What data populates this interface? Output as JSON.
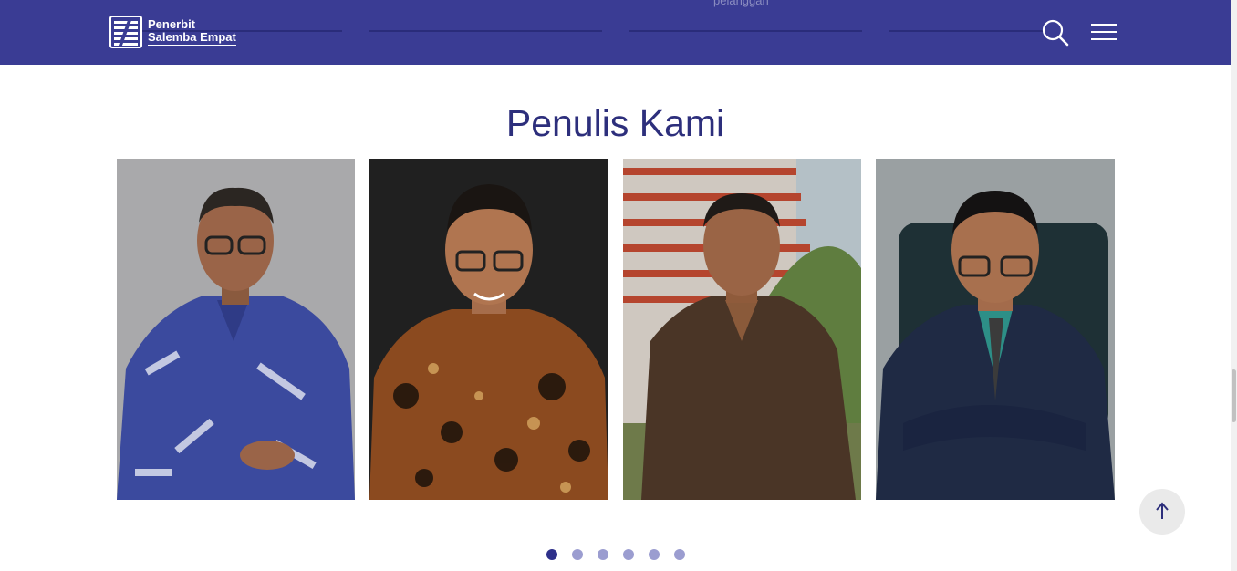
{
  "header": {
    "brand_line1": "Penerbit",
    "brand_line2": "Salemba Empat",
    "faded_caption": "pelanggan",
    "icons": {
      "search": "search-icon",
      "menu": "hamburger-menu-icon"
    },
    "bg_color": "#3a3c94"
  },
  "section": {
    "title": "Penulis Kami"
  },
  "authors": [
    {
      "name": "author-1",
      "shirt": "blue-white batik"
    },
    {
      "name": "author-2",
      "shirt": "brown batik"
    },
    {
      "name": "author-3",
      "shirt": "brown jacket"
    },
    {
      "name": "author-4",
      "shirt": "navy suit"
    }
  ],
  "carousel": {
    "pages": 6,
    "active_page": 1
  },
  "back_to_top": {
    "icon": "arrow-up-icon"
  },
  "colors": {
    "accent": "#2d2f7c",
    "dot_inactive": "#9b9dd0",
    "dot_active": "#2e308a"
  }
}
